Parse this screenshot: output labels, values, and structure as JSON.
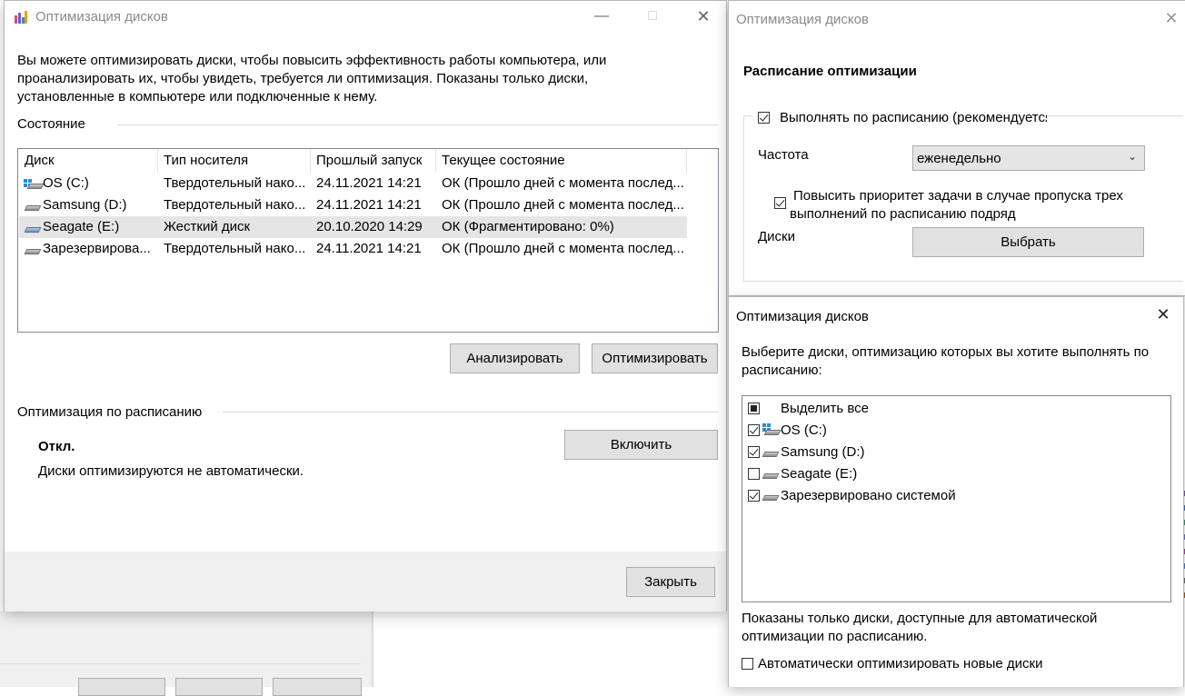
{
  "main": {
    "title": "Оптимизация дисков",
    "description": "Вы можете оптимизировать диски, чтобы повысить эффективность работы  компьютера, или проанализировать их, чтобы увидеть, требуется ли оптимизация. Показаны только диски, установленные в компьютере или подключенные к нему.",
    "status_label": "Состояние",
    "columns": [
      "Диск",
      "Тип носителя",
      "Прошлый запуск",
      "Текущее состояние"
    ],
    "drives": [
      {
        "name": "OS (C:)",
        "type": "Твердотельный нако...",
        "last_run": "24.11.2021 14:21",
        "status": "ОК (Прошло дней с момента послед...",
        "icon": "os-drive-icon"
      },
      {
        "name": "Samsung (D:)",
        "type": "Твердотельный нако...",
        "last_run": "24.11.2021 14:21",
        "status": "ОК (Прошло дней с момента послед...",
        "icon": "drive-icon"
      },
      {
        "name": "Seagate (E:)",
        "type": "Жесткий диск",
        "last_run": "20.10.2020 14:29",
        "status": "ОК (Фрагментировано: 0%)",
        "icon": "hdd-icon"
      },
      {
        "name": "Зарезервирова...",
        "type": "Твердотельный нако...",
        "last_run": "24.11.2021 14:21",
        "status": "ОК (Прошло дней с момента послед...",
        "icon": "drive-icon"
      }
    ],
    "analyze_label": "Анализировать",
    "optimize_label": "Оптимизировать",
    "schedule_label": "Оптимизация по расписанию",
    "schedule_state": "Откл.",
    "schedule_desc": "Диски оптимизируются не автоматически.",
    "enable_label": "Включить",
    "close_label": "Закрыть"
  },
  "schedule_window": {
    "title": "Оптимизация дисков",
    "heading": "Расписание оптимизации",
    "run_on_schedule": "Выполнять по расписанию (рекомендуется)",
    "frequency_label": "Частота",
    "frequency_value": "еженедельно",
    "priority_label": "Повысить приоритет задачи в случае пропуска трех выполнений по расписанию подряд",
    "disks_label": "Диски",
    "choose_label": "Выбрать"
  },
  "select_window": {
    "title": "Оптимизация дисков",
    "instruction": "Выберите диски, оптимизацию которых вы хотите выполнять по расписанию:",
    "items": [
      {
        "label": "Выделить все",
        "state": "partial"
      },
      {
        "label": "OS (C:)",
        "state": "checked"
      },
      {
        "label": "Samsung (D:)",
        "state": "checked"
      },
      {
        "label": "Seagate (E:)",
        "state": "unchecked"
      },
      {
        "label": "Зарезервировано системой",
        "state": "checked"
      }
    ],
    "footnote": "Показаны только диски, доступные для автоматической оптимизации по расписанию.",
    "auto_new_label": "Автоматически оптимизировать новые диски"
  },
  "colors": {
    "accent": "#1e90d8",
    "button": "#e1e1e1",
    "selected_row": "#e5e5e5"
  }
}
